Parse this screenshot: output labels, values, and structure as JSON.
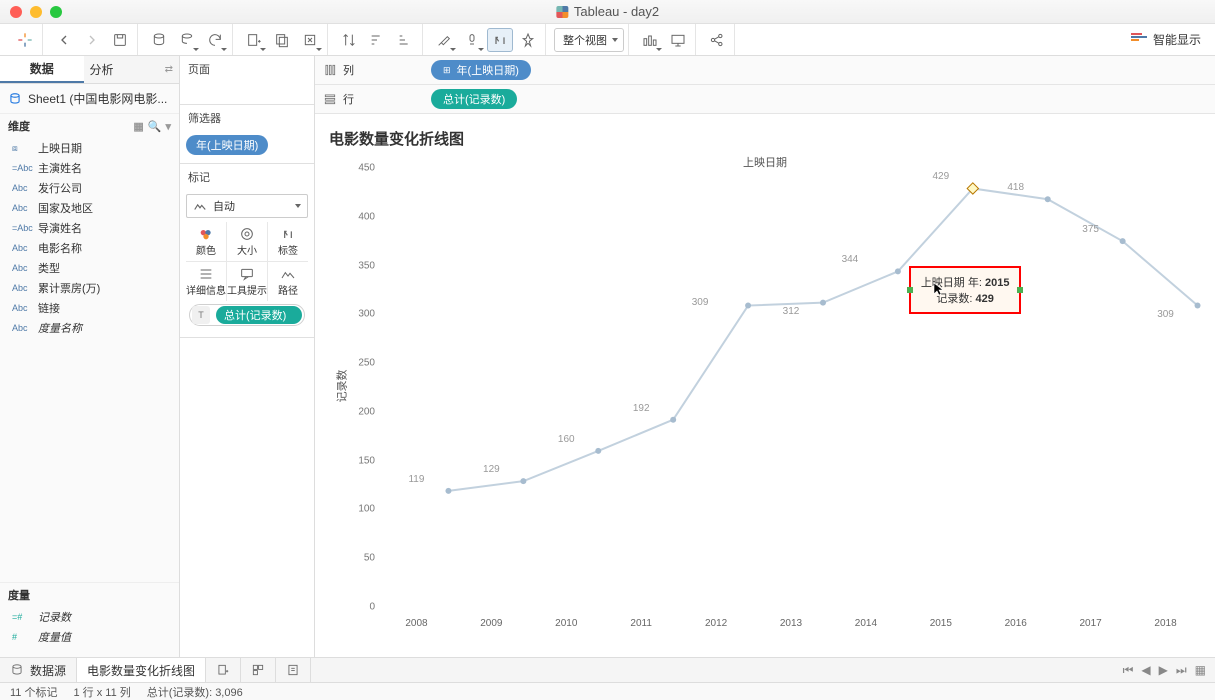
{
  "window": {
    "title": "Tableau - day2"
  },
  "toolbar": {
    "fit_label": "整个视图"
  },
  "show_me": {
    "label": "智能显示"
  },
  "left": {
    "tab_data": "数据",
    "tab_analysis": "分析",
    "datasource": "Sheet1 (中国电影网电影...",
    "dimensions_header": "维度",
    "measures_header": "度量",
    "dims": [
      {
        "type": "⧈",
        "name": "上映日期"
      },
      {
        "type": "=Abc",
        "name": "主演姓名"
      },
      {
        "type": "Abc",
        "name": "发行公司"
      },
      {
        "type": "Abc",
        "name": "国家及地区"
      },
      {
        "type": "=Abc",
        "name": "导演姓名"
      },
      {
        "type": "Abc",
        "name": "电影名称"
      },
      {
        "type": "Abc",
        "name": "类型"
      },
      {
        "type": "Abc",
        "name": "累计票房(万)"
      },
      {
        "type": "Abc",
        "name": "链接"
      },
      {
        "type": "Abc",
        "name": "度量名称",
        "italic": true
      }
    ],
    "meas": [
      {
        "type": "=#",
        "name": "记录数",
        "italic": true
      },
      {
        "type": "#",
        "name": "度量值",
        "italic": true
      }
    ]
  },
  "cards": {
    "pages": "页面",
    "filters": "筛选器",
    "filter_pill": "年(上映日期)",
    "marks": "标记",
    "mark_type": "自动",
    "grid": [
      "颜色",
      "大小",
      "标签",
      "详细信息",
      "工具提示",
      "路径"
    ],
    "mark_pill": "总计(记录数)"
  },
  "shelves": {
    "columns_label": "列",
    "rows_label": "行",
    "col_pill": "年(上映日期)",
    "row_pill": "总计(记录数)"
  },
  "viz": {
    "title": "电影数量变化折线图",
    "x_axis_title": "上映日期",
    "y_axis_title": "记录数"
  },
  "tooltip": {
    "line1_label": "上映日期 年: ",
    "line1_value": "2015",
    "line2_label": "记录数: ",
    "line2_value": "429"
  },
  "bottom": {
    "datasource": "数据源",
    "sheet": "电影数量变化折线图"
  },
  "status": {
    "marks": "11 个标记",
    "rowscols": "1 行 x 11 列",
    "sum": "总计(记录数): 3,096"
  },
  "chart_data": {
    "type": "line",
    "title": "电影数量变化折线图",
    "xlabel": "上映日期",
    "ylabel": "记录数",
    "categories": [
      "2008",
      "2009",
      "2010",
      "2011",
      "2012",
      "2013",
      "2014",
      "2015",
      "2016",
      "2017",
      "2018"
    ],
    "values": [
      119,
      129,
      160,
      192,
      309,
      312,
      344,
      429,
      418,
      375,
      309
    ],
    "ylim": [
      0,
      450
    ],
    "y_ticks": [
      0,
      50,
      100,
      150,
      200,
      250,
      300,
      350,
      400,
      450
    ],
    "highlighted_index": 7,
    "tooltip": {
      "x_label": "上映日期 年",
      "x": "2015",
      "y_label": "记录数",
      "y": 429
    }
  }
}
